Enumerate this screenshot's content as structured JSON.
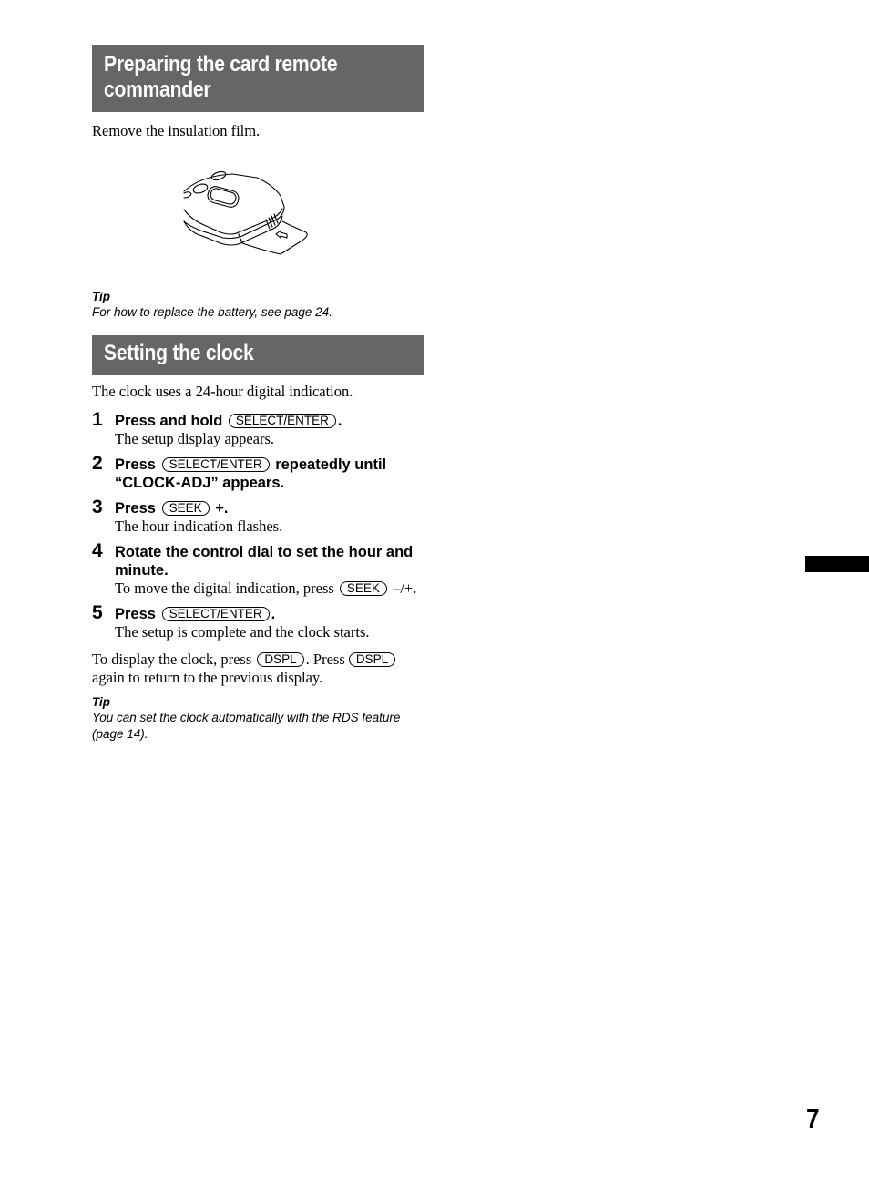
{
  "section1": {
    "heading_line1": "Preparing the card remote",
    "heading_line2": "commander",
    "intro": "Remove the insulation film.",
    "illustration": "card-remote-insulation-film-illustration",
    "tip": {
      "label": "Tip",
      "text": "For how to replace the battery, see page 24."
    }
  },
  "section2": {
    "heading": "Setting the clock",
    "intro": "The clock uses a 24-hour digital indication.",
    "steps": [
      {
        "number": "1",
        "title_before": "Press and hold",
        "key": "SELECT/ENTER",
        "title_after": ".",
        "body": "The setup display appears."
      },
      {
        "number": "2",
        "title_before": "Press",
        "key": "SELECT/ENTER",
        "title_after": "repeatedly until “CLOCK-ADJ” appears."
      },
      {
        "number": "3",
        "title_before": "Press",
        "key": "SEEK",
        "title_after": "+.",
        "body": "The hour indication flashes."
      },
      {
        "number": "4",
        "title": "Rotate the control dial to set the hour and minute.",
        "body_before": "To move the digital indication, press",
        "key": "SEEK",
        "body_after": "–/+."
      },
      {
        "number": "5",
        "title_before": "Press",
        "key": "SELECT/ENTER",
        "title_after": ".",
        "body": "The setup is complete and the clock starts."
      }
    ],
    "display_note": {
      "part1": "To display the clock, press",
      "key1": "DSPL",
      "part2": ". Press",
      "key2": "DSPL",
      "part3": "again to return to the previous display."
    },
    "tip": {
      "label": "Tip",
      "text": "You can set the clock automatically with the RDS feature (page 14)."
    }
  },
  "page": {
    "number": "7"
  }
}
